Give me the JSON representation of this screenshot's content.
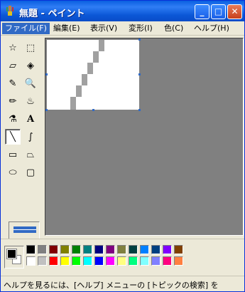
{
  "window": {
    "title": "無題 - ペイント",
    "controls": {
      "minimize": "_",
      "maximize": "□",
      "close": "✕"
    }
  },
  "menu": {
    "items": [
      "ファイル(F)",
      "編集(E)",
      "表示(V)",
      "変形(I)",
      "色(C)",
      "ヘルプ(H)"
    ]
  },
  "toolbox": {
    "tools": [
      {
        "name": "free-select-icon",
        "glyph": "☆"
      },
      {
        "name": "rect-select-icon",
        "glyph": "⬚"
      },
      {
        "name": "eraser-icon",
        "glyph": "▱"
      },
      {
        "name": "fill-icon",
        "glyph": "◈"
      },
      {
        "name": "pick-color-icon",
        "glyph": "✎"
      },
      {
        "name": "magnifier-icon",
        "glyph": "🔍"
      },
      {
        "name": "pencil-icon",
        "glyph": "✏"
      },
      {
        "name": "brush-icon",
        "glyph": "♨"
      },
      {
        "name": "airbrush-icon",
        "glyph": "⚗"
      },
      {
        "name": "text-icon",
        "glyph": "A"
      },
      {
        "name": "line-icon",
        "glyph": "╲"
      },
      {
        "name": "curve-icon",
        "glyph": "∫"
      },
      {
        "name": "rectangle-icon",
        "glyph": "▭"
      },
      {
        "name": "polygon-icon",
        "glyph": "⏢"
      },
      {
        "name": "ellipse-icon",
        "glyph": "⬭"
      },
      {
        "name": "rounded-rect-icon",
        "glyph": "▢"
      }
    ]
  },
  "colors": {
    "foreground": "#000000",
    "background": "#ffffff",
    "palette_row1": [
      "#000000",
      "#808080",
      "#800000",
      "#808000",
      "#008000",
      "#008080",
      "#000080",
      "#800080",
      "#808040",
      "#004040",
      "#0080ff",
      "#004080",
      "#8000ff",
      "#804000"
    ],
    "palette_row2": [
      "#ffffff",
      "#c0c0c0",
      "#ff0000",
      "#ffff00",
      "#00ff00",
      "#00ffff",
      "#0000ff",
      "#ff00ff",
      "#ffff80",
      "#00ff80",
      "#80ffff",
      "#8080ff",
      "#ff0080",
      "#ff8040"
    ]
  },
  "status": {
    "text": "ヘルプを見るには、[ヘルプ] メニューの [トピックの検索] を"
  }
}
